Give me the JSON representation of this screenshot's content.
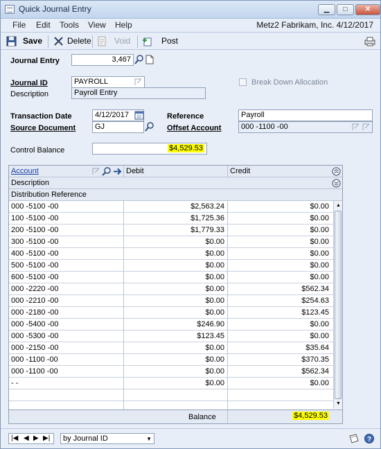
{
  "window": {
    "title": "Quick Journal Entry",
    "company_info": "Metz2  Fabrikam, Inc.  4/12/2017"
  },
  "menu": [
    "File",
    "Edit",
    "Tools",
    "View",
    "Help"
  ],
  "toolbar": {
    "save": "Save",
    "delete": "Delete",
    "void": "Void",
    "post": "Post"
  },
  "form": {
    "journal_entry_label": "Journal Entry",
    "journal_entry_value": "3,467",
    "journal_id_label": "Journal ID",
    "journal_id_value": "PAYROLL",
    "description_label": "Description",
    "description_value": "Payroll Entry",
    "break_down_label": "Break Down Allocation",
    "transaction_date_label": "Transaction Date",
    "transaction_date_value": "4/12/2017",
    "source_document_label": "Source Document",
    "source_document_value": "GJ",
    "reference_label": "Reference",
    "reference_value": "Payroll",
    "offset_account_label": "Offset Account",
    "offset_account_value": "000 -1100 -00",
    "control_balance_label": "Control Balance",
    "control_balance_value": "$4,529.53"
  },
  "grid": {
    "headers": {
      "account": "Account",
      "debit": "Debit",
      "credit": "Credit",
      "description": "Description",
      "distribution_reference": "Distribution Reference"
    },
    "rows": [
      {
        "account": "000 -5100 -00",
        "debit": "$2,563.24",
        "credit": "$0.00"
      },
      {
        "account": "100 -5100 -00",
        "debit": "$1,725.36",
        "credit": "$0.00"
      },
      {
        "account": "200 -5100 -00",
        "debit": "$1,779.33",
        "credit": "$0.00"
      },
      {
        "account": "300 -5100 -00",
        "debit": "$0.00",
        "credit": "$0.00"
      },
      {
        "account": "400 -5100 -00",
        "debit": "$0.00",
        "credit": "$0.00"
      },
      {
        "account": "500 -5100 -00",
        "debit": "$0.00",
        "credit": "$0.00"
      },
      {
        "account": "600 -5100 -00",
        "debit": "$0.00",
        "credit": "$0.00"
      },
      {
        "account": "000 -2220 -00",
        "debit": "$0.00",
        "credit": "$562.34"
      },
      {
        "account": "000 -2210 -00",
        "debit": "$0.00",
        "credit": "$254.63"
      },
      {
        "account": "000 -2180 -00",
        "debit": "$0.00",
        "credit": "$123.45"
      },
      {
        "account": "000 -5400 -00",
        "debit": "$246.90",
        "credit": "$0.00"
      },
      {
        "account": "000 -5300 -00",
        "debit": "$123.45",
        "credit": "$0.00"
      },
      {
        "account": "000 -2150 -00",
        "debit": "$0.00",
        "credit": "$35.64"
      },
      {
        "account": "000 -1100 -00",
        "debit": "$0.00",
        "credit": "$370.35"
      },
      {
        "account": "000 -1100 -00",
        "debit": "$0.00",
        "credit": "$562.34"
      },
      {
        "account": "    -        -",
        "debit": "$0.00",
        "credit": "$0.00"
      },
      {
        "account": "",
        "debit": "",
        "credit": ""
      },
      {
        "account": "",
        "debit": "",
        "credit": ""
      }
    ],
    "balance_label": "Balance",
    "balance_value": "$4,529.53"
  },
  "footer": {
    "sort_value": "by Journal ID"
  },
  "colors": {
    "highlight": "#ffff00",
    "window_bg": "#e7eef8"
  }
}
